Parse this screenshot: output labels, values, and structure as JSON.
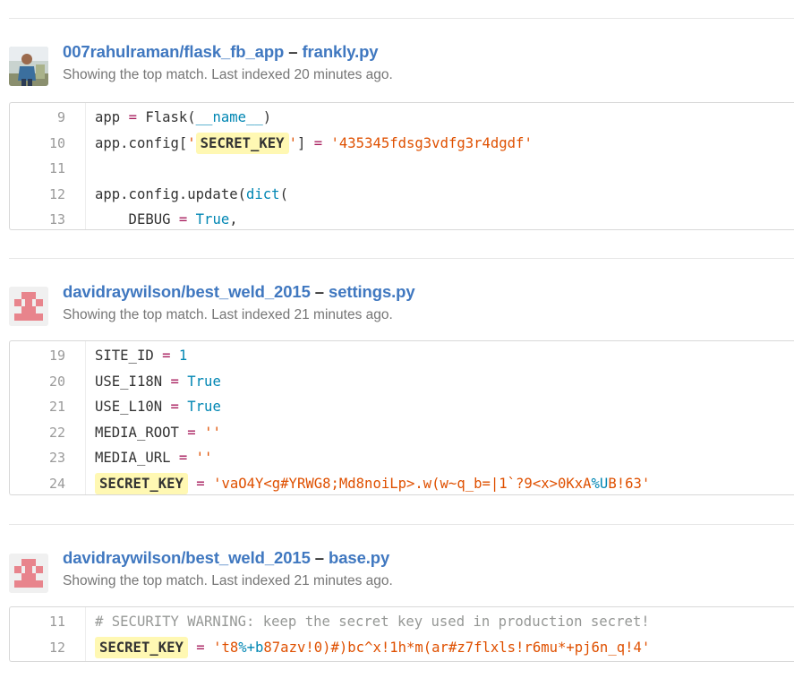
{
  "results": [
    {
      "repo": "007rahulraman/flask_fb_app",
      "file": "frankly.py",
      "meta": "Showing the top match. Last indexed 20 minutes ago.",
      "lines": [
        {
          "n": "9",
          "tokens": [
            [
              "t",
              "app "
            ],
            [
              "op",
              "="
            ],
            [
              "t",
              " Flask("
            ],
            [
              "kw",
              "__name__"
            ],
            [
              "t",
              ")"
            ]
          ]
        },
        {
          "n": "10",
          "tokens": [
            [
              "t",
              "app.config["
            ],
            [
              "str",
              "'"
            ],
            [
              "hl",
              "SECRET_KEY"
            ],
            [
              "str",
              "'"
            ],
            [
              "t",
              "] "
            ],
            [
              "op",
              "="
            ],
            [
              "t",
              " "
            ],
            [
              "str",
              "'435345fdsg3vdfg3r4dgdf'"
            ]
          ]
        },
        {
          "n": "11",
          "tokens": []
        },
        {
          "n": "12",
          "tokens": [
            [
              "t",
              "app.config.update("
            ],
            [
              "kw",
              "dict"
            ],
            [
              "t",
              "("
            ]
          ]
        },
        {
          "n": "13",
          "tokens": [
            [
              "t",
              "    DEBUG "
            ],
            [
              "op",
              "="
            ],
            [
              "t",
              " "
            ],
            [
              "kw",
              "True"
            ],
            [
              "t",
              ","
            ]
          ]
        }
      ]
    },
    {
      "repo": "davidraywilson/best_weld_2015",
      "file": "settings.py",
      "meta": "Showing the top match. Last indexed 21 minutes ago.",
      "lines": [
        {
          "n": "19",
          "tokens": [
            [
              "t",
              "SITE_ID "
            ],
            [
              "op",
              "="
            ],
            [
              "t",
              " "
            ],
            [
              "kw",
              "1"
            ]
          ]
        },
        {
          "n": "20",
          "tokens": [
            [
              "t",
              "USE_I18N "
            ],
            [
              "op",
              "="
            ],
            [
              "t",
              " "
            ],
            [
              "kw",
              "True"
            ]
          ]
        },
        {
          "n": "21",
          "tokens": [
            [
              "t",
              "USE_L10N "
            ],
            [
              "op",
              "="
            ],
            [
              "t",
              " "
            ],
            [
              "kw",
              "True"
            ]
          ]
        },
        {
          "n": "22",
          "tokens": [
            [
              "t",
              "MEDIA_ROOT "
            ],
            [
              "op",
              "="
            ],
            [
              "t",
              " "
            ],
            [
              "str",
              "''"
            ]
          ]
        },
        {
          "n": "23",
          "tokens": [
            [
              "t",
              "MEDIA_URL "
            ],
            [
              "op",
              "="
            ],
            [
              "t",
              " "
            ],
            [
              "str",
              "''"
            ]
          ]
        },
        {
          "n": "24",
          "tokens": [
            [
              "hl",
              "SECRET_KEY"
            ],
            [
              "t",
              " "
            ],
            [
              "op",
              "="
            ],
            [
              "t",
              " "
            ],
            [
              "str",
              "'vaO4Y<g#YRWG8;Md8noiLp>.w(w~q_b=|1`?9<x>0KxA"
            ],
            [
              "kw",
              "%U"
            ],
            [
              "str",
              "B!63'"
            ]
          ]
        }
      ]
    },
    {
      "repo": "davidraywilson/best_weld_2015",
      "file": "base.py",
      "meta": "Showing the top match. Last indexed 21 minutes ago.",
      "lines": [
        {
          "n": "11",
          "tokens": [
            [
              "cm",
              "# SECURITY WARNING: keep the secret key used in production secret!"
            ]
          ]
        },
        {
          "n": "12",
          "tokens": [
            [
              "hl",
              "SECRET_KEY"
            ],
            [
              "t",
              " "
            ],
            [
              "op",
              "="
            ],
            [
              "t",
              " "
            ],
            [
              "str",
              "'t8"
            ],
            [
              "kw",
              "%+b"
            ],
            [
              "str",
              "87azv!0)#)bc^x!1h*m(ar#z7flxls!r6mu*+pj6n_q!4'"
            ]
          ]
        }
      ]
    }
  ],
  "separator": "–",
  "colors": {
    "link": "#4078c0",
    "highlight": "#fff8b3",
    "string": "#df5000",
    "keyword": "#0086b3",
    "operator": "#a71d5d"
  }
}
